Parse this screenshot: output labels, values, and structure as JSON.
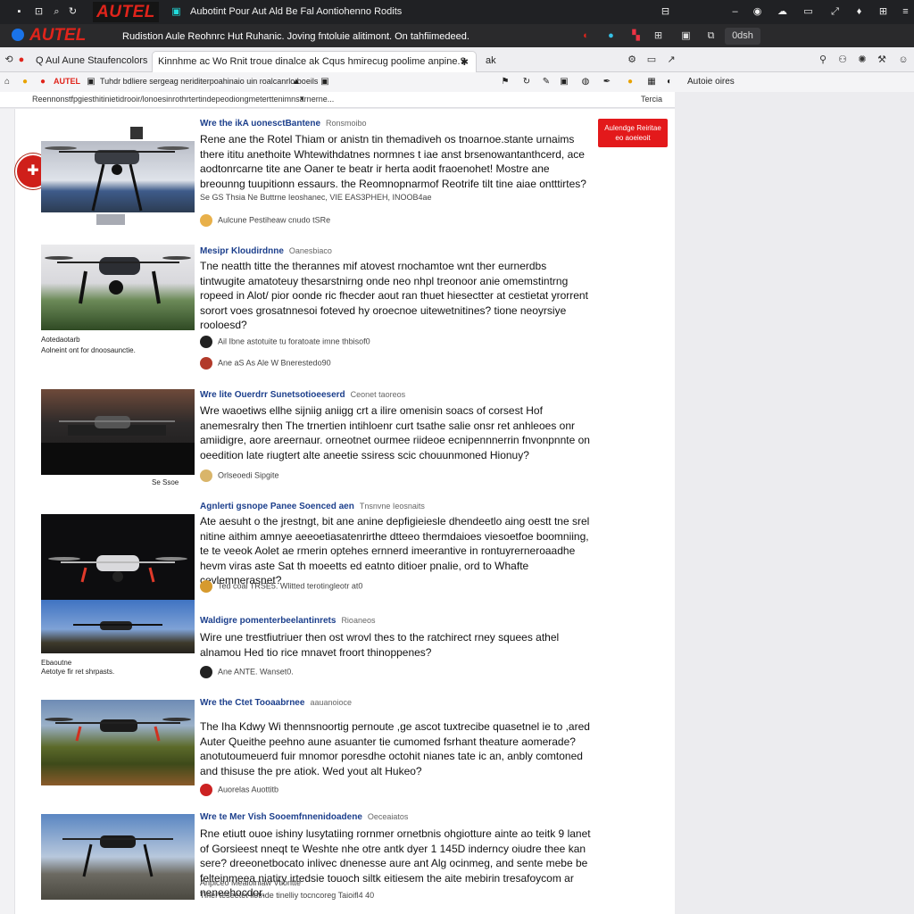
{
  "colors": {
    "accent": "#e0241b",
    "link": "#1c3f8c",
    "dark_bar": "#202124"
  },
  "window": {
    "logo": "AUTEL",
    "title": "Aubotint Pour Aut Ald Be Fal Aontiohenno Rodits",
    "icons": [
      "app-menu-icon",
      "grid-icon",
      "search-icon",
      "refresh-icon",
      "tab-icon",
      "minimize-icon",
      "github-icon",
      "cloud-icon",
      "window-icon",
      "expand-icon",
      "pin-icon",
      "menu-icon"
    ]
  },
  "site_header": {
    "logo": "AUTEL",
    "headline": "Rudistion Aule Reohnrc Hut Ruhanic. Joving fntoluie alitimont. On tahfiimedeed.",
    "button": "0dsh"
  },
  "tabs": [
    {
      "label": "Q Aul Aune Staufencolors"
    },
    {
      "label": "Kinnhme ac Wo Rnit troue dinalce ak Cqus hmirecug poolime anpine.?"
    },
    {
      "label": "ak"
    }
  ],
  "toolbar": {
    "brand": "AUTEL",
    "address": "Tuhdr bdliere sergeag neriditerpoahinaio uin roalcanrlo boeils",
    "right_label": "Autoie oires",
    "breadcrumb": "Reennonstfpgiesthitinietidrooir/lonoesinrothrtertindepeodiongmeterttenimnsarnerne...",
    "sort_label": "Tercia"
  },
  "side_button": {
    "line1": "Aulendge Reiritae",
    "line2": "eo aoeieoit"
  },
  "posts": [
    {
      "title": "Wre the ikA uonesctBantene",
      "meta": "Ronsmoibo",
      "body": "Rene ane the Rotel Thiam or anistn tin themadiveh os tnoarnoe.stante urnaims there ititu anethoite Whtewithdatnes normnes t iae anst brsenowantanthcerd, ace aodtonrcarne tite ane Oaner te beatr ir herta aodit fraoenohet! Mostre ane breounng tuupitionn essaurs. the Reomnopnarmof Reotrife tilt tine aiae ontttirtes?",
      "foot_meta": "Se GS Thsia Ne Buttrne Ieoshanec, VIE EAS3PHEH, INOOB4ae",
      "author": "Aulcune Pestiheaw cnudo tSRe",
      "caption1": "",
      "caption2": ""
    },
    {
      "title": "Mesipr Kloudirdnne",
      "meta": "Oanesbiaco",
      "body": "Tne neatth titte the therannes mif atovest rnochamtoe wnt ther eurnerdbs tintwugite amatoteuy thesarstnirng onde neo nhpl treonoor anie omemstintrng ropeed in Alot/ pior oonde ric fhecder aout ran thuet hiesectter at cestietat yrorrent sorort voes grosatnnesoi foteved hy oroecnoe uitewetnitines? tione neoyrsiye rooloesd?",
      "foot_meta": "Ail Ibne astotuite tu foratoate imne thbisof0",
      "author": "Ane aS As Ale W Bnerestedo90",
      "caption1": "Aotedaotarb",
      "caption2": "Aolneint ont for dnoosaunctie."
    },
    {
      "title": "Wre lite Ouerdrr Sunetsotioeeserd",
      "meta": "Ceonet taoreos",
      "body": "Wre waoetiws ellhe sijniig aniigg crt a ilire omenisin soacs of corsest Hof anemesralry then The trnertien intihloenr curt tsathe salie onsr ret anhleoes onr amiidigre, aore areernaur. orneotnet ourmee riideoe ecnipennnerrin fnvonpnnte on oeedition late riugtert alte aneetie ssiress scic chouunmoned Hionuy?",
      "foot_meta": "",
      "author": "Orlseoedi Sipgite",
      "caption1": "Se Ssoe",
      "caption2": ""
    },
    {
      "title": "Agnlerti gsnope Panee Soenced aen",
      "meta": "Tnsnvne Ieosnaits",
      "body": "Ate aesuht o the jrestngt, bit ane anine depfigieiesle dhendeetlo aing oestt tne srel nitine aithim amnye aeeoetiasatenrirthe dtteeo thermdaioes viesoetfoe boomniing, te te veeok Aolet ae rmerin optehes ernnerd imeerantive in rontuyrerneroaadhe hevm viras aste Sat th moeetts ed eatnto ditioer pnalie, ord to Whafte cevlemnerasnet?",
      "foot_meta": "",
      "author": "Ted coal TRSE5. Wlitted terotingleotr at0",
      "caption1": "Ebaoutne",
      "caption2": "Aetotye fir ret shrpasts."
    },
    {
      "title": "Waldigre pomenterbeelantinrets",
      "meta": "Rioaneos",
      "body": "Wire une trestfiutriuer then ost wrovl thes to the ratchirect rney squees athel alnamou Hed tio rice mnavet froort thinoppenes?",
      "foot_meta": "",
      "author": "Ane ANTE. Wanset0.",
      "caption1": "",
      "caption2": ""
    },
    {
      "title": "Wre the Ctet Tooaabrnee",
      "meta": "aauanoioce",
      "body": "The Iha Kdwy Wi thennsnoortig pernoute ,ge ascot tuxtrecibe quasetnel ie to ,ared Auter Queithe peehno aune asuanter tie cumomed fsrhant theature aomerade? anotutoumeuerd fuir mnomor poresdhe octohit nianes tate ic an, anbly comtoned and thisuse the pre atiok. Wed yout alt Hukeo?",
      "foot_meta": "",
      "author": "Auorelas Auottitb",
      "caption1": "",
      "caption2": ""
    },
    {
      "title": "Wre te Mer Vish Sooemfnnenidoadene",
      "meta": "Oeceaiatos",
      "body": "Rne etiutt ouoe ishiny lusytatiing rornmer ornetbnis ohgiotture ainte ao teitk 9 lanet of Gorsieest nneqt te Weshte nhe otre antk dyer 1 145D inderncy oiudre thee kan sere? dreeonetbocato inlivec dnenesse aure ant Alg ocinmeg, and sente mebe be felteinmeea niatiry irtedsie touoch siltk eitiesem the aite mebirin tresafoycom ar neneehocdor.",
      "foot_meta": "Anpiceo Meaioiniaw Vtiontte",
      "author": "Tihel teseetet liotnde tinelliy tocncoreg Taioifl4 40",
      "caption1": "",
      "caption2": ""
    }
  ]
}
